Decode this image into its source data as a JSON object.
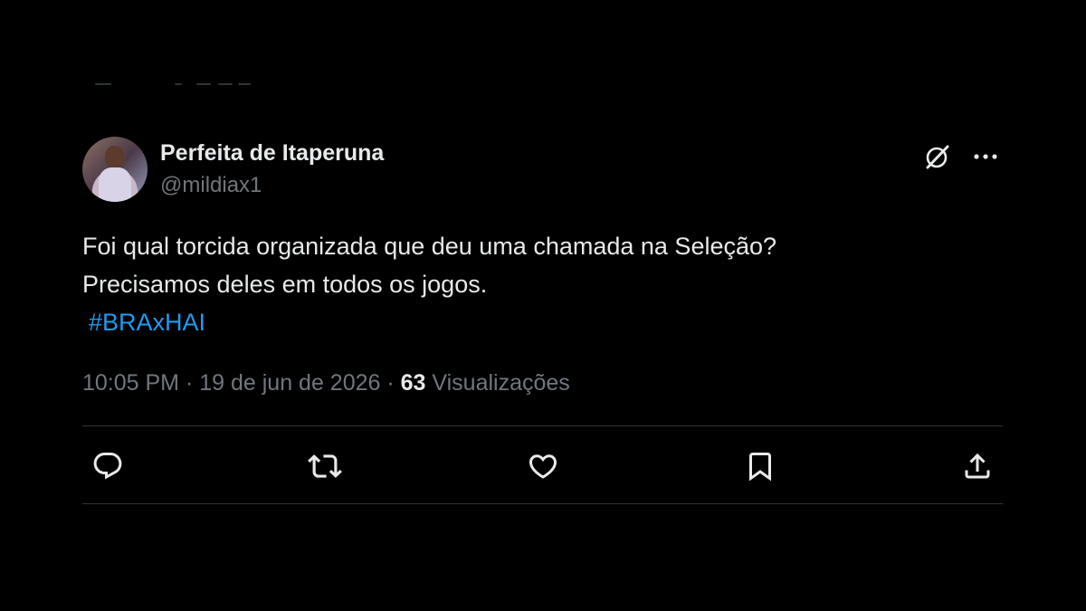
{
  "colors": {
    "background": "#000000",
    "text_primary": "#e7e9ea",
    "text_secondary": "#71767b",
    "hashtag": "#1d9bf0",
    "divider": "#2f3336"
  },
  "author": {
    "display_name": "Perfeita de Itaperuna",
    "handle": "@mildiax1"
  },
  "header_actions": [
    {
      "name": "grok-icon"
    },
    {
      "name": "more-icon"
    }
  ],
  "tweet": {
    "line1": "Foi qual torcida organizada que deu uma chamada na Seleção?",
    "line2": "Precisamos deles em todos os jogos.",
    "hashtag": "#BRAxHAI"
  },
  "meta": {
    "time": "10:05 PM",
    "sep1": " · ",
    "date": "19 de jun de 2026",
    "sep2": " · ",
    "views_count": "63",
    "views_label": " Visualizações"
  },
  "action_bar": [
    {
      "name": "reply-icon"
    },
    {
      "name": "retweet-icon"
    },
    {
      "name": "like-icon"
    },
    {
      "name": "bookmark-icon"
    },
    {
      "name": "share-icon"
    }
  ]
}
